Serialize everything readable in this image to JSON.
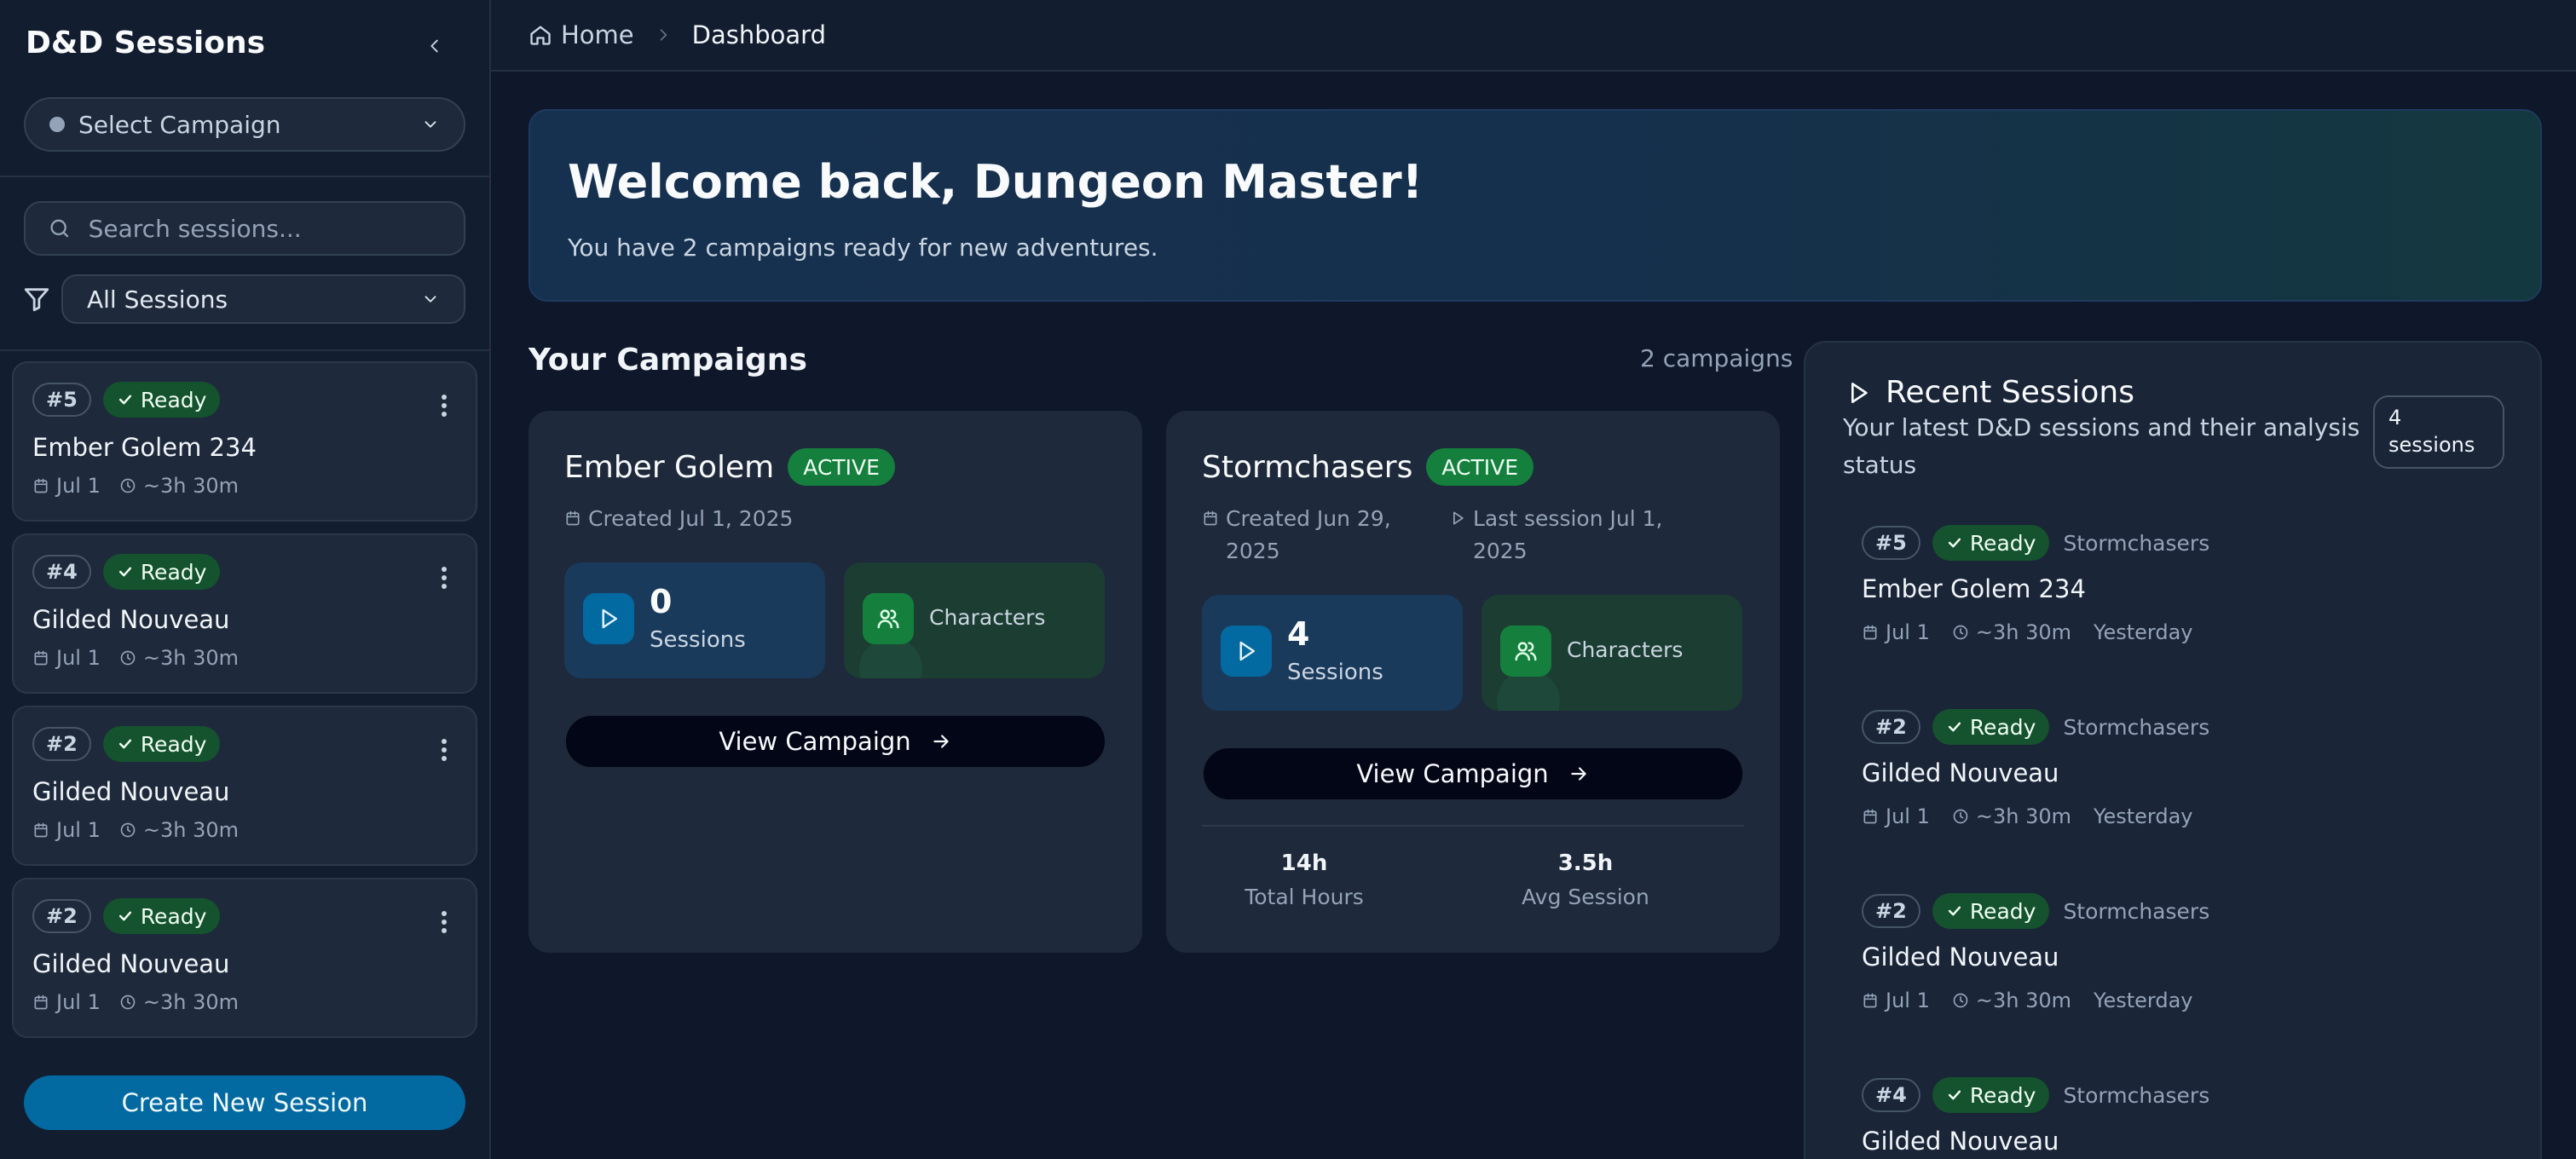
{
  "sidebar": {
    "title": "D&D Sessions",
    "campaign_select": "Select Campaign",
    "search_placeholder": "Search sessions...",
    "filter": "All Sessions",
    "sessions": [
      {
        "num": "#5",
        "status": "Ready",
        "name": "Ember Golem 234",
        "date": "Jul 1",
        "duration": "~3h 30m"
      },
      {
        "num": "#4",
        "status": "Ready",
        "name": "Gilded Nouveau",
        "date": "Jul 1",
        "duration": "~3h 30m"
      },
      {
        "num": "#2",
        "status": "Ready",
        "name": "Gilded Nouveau",
        "date": "Jul 1",
        "duration": "~3h 30m"
      },
      {
        "num": "#2",
        "status": "Ready",
        "name": "Gilded Nouveau",
        "date": "Jul 1",
        "duration": "~3h 30m"
      }
    ],
    "create_button": "Create New Session"
  },
  "breadcrumb": {
    "home": "Home",
    "current": "Dashboard"
  },
  "welcome": {
    "title": "Welcome back, Dungeon Master!",
    "subtitle": "You have 2 campaigns ready for new adventures."
  },
  "campaigns_section": {
    "title": "Your Campaigns",
    "count": "2 campaigns",
    "campaigns": [
      {
        "name": "Ember Golem",
        "status": "ACTIVE",
        "created": "Created Jul 1, 2025",
        "sessions_count": "0",
        "sessions_label": "Sessions",
        "characters_label": "Characters",
        "view_button": "View Campaign"
      },
      {
        "name": "Stormchasers",
        "status": "ACTIVE",
        "created_line1": "Created Jun 29,",
        "created_line2": "2025",
        "last_line1": "Last session Jul 1,",
        "last_line2": "2025",
        "sessions_count": "4",
        "sessions_label": "Sessions",
        "characters_label": "Characters",
        "view_button": "View Campaign",
        "total_hours": "14h",
        "total_hours_label": "Total Hours",
        "avg_session": "3.5h",
        "avg_session_label": "Avg Session"
      }
    ]
  },
  "recent_sessions": {
    "title": "Recent Sessions",
    "subtitle": "Your latest D&D sessions and their analysis status",
    "count_line1": "4",
    "count_line2": "sessions",
    "items": [
      {
        "num": "#5",
        "status": "Ready",
        "campaign": "Stormchasers",
        "name": "Ember Golem 234",
        "date": "Jul 1",
        "duration": "~3h 30m",
        "when": "Yesterday"
      },
      {
        "num": "#2",
        "status": "Ready",
        "campaign": "Stormchasers",
        "name": "Gilded Nouveau",
        "date": "Jul 1",
        "duration": "~3h 30m",
        "when": "Yesterday"
      },
      {
        "num": "#2",
        "status": "Ready",
        "campaign": "Stormchasers",
        "name": "Gilded Nouveau",
        "date": "Jul 1",
        "duration": "~3h 30m",
        "when": "Yesterday"
      },
      {
        "num": "#4",
        "status": "Ready",
        "campaign": "Stormchasers",
        "name": "Gilded Nouveau"
      }
    ]
  },
  "colors": {
    "background": "#0f172a",
    "sidebar": "#131d30",
    "card": "#1e293b",
    "primary": "#0369a1",
    "ready_badge": "#14532d",
    "active_badge": "#15803d"
  }
}
